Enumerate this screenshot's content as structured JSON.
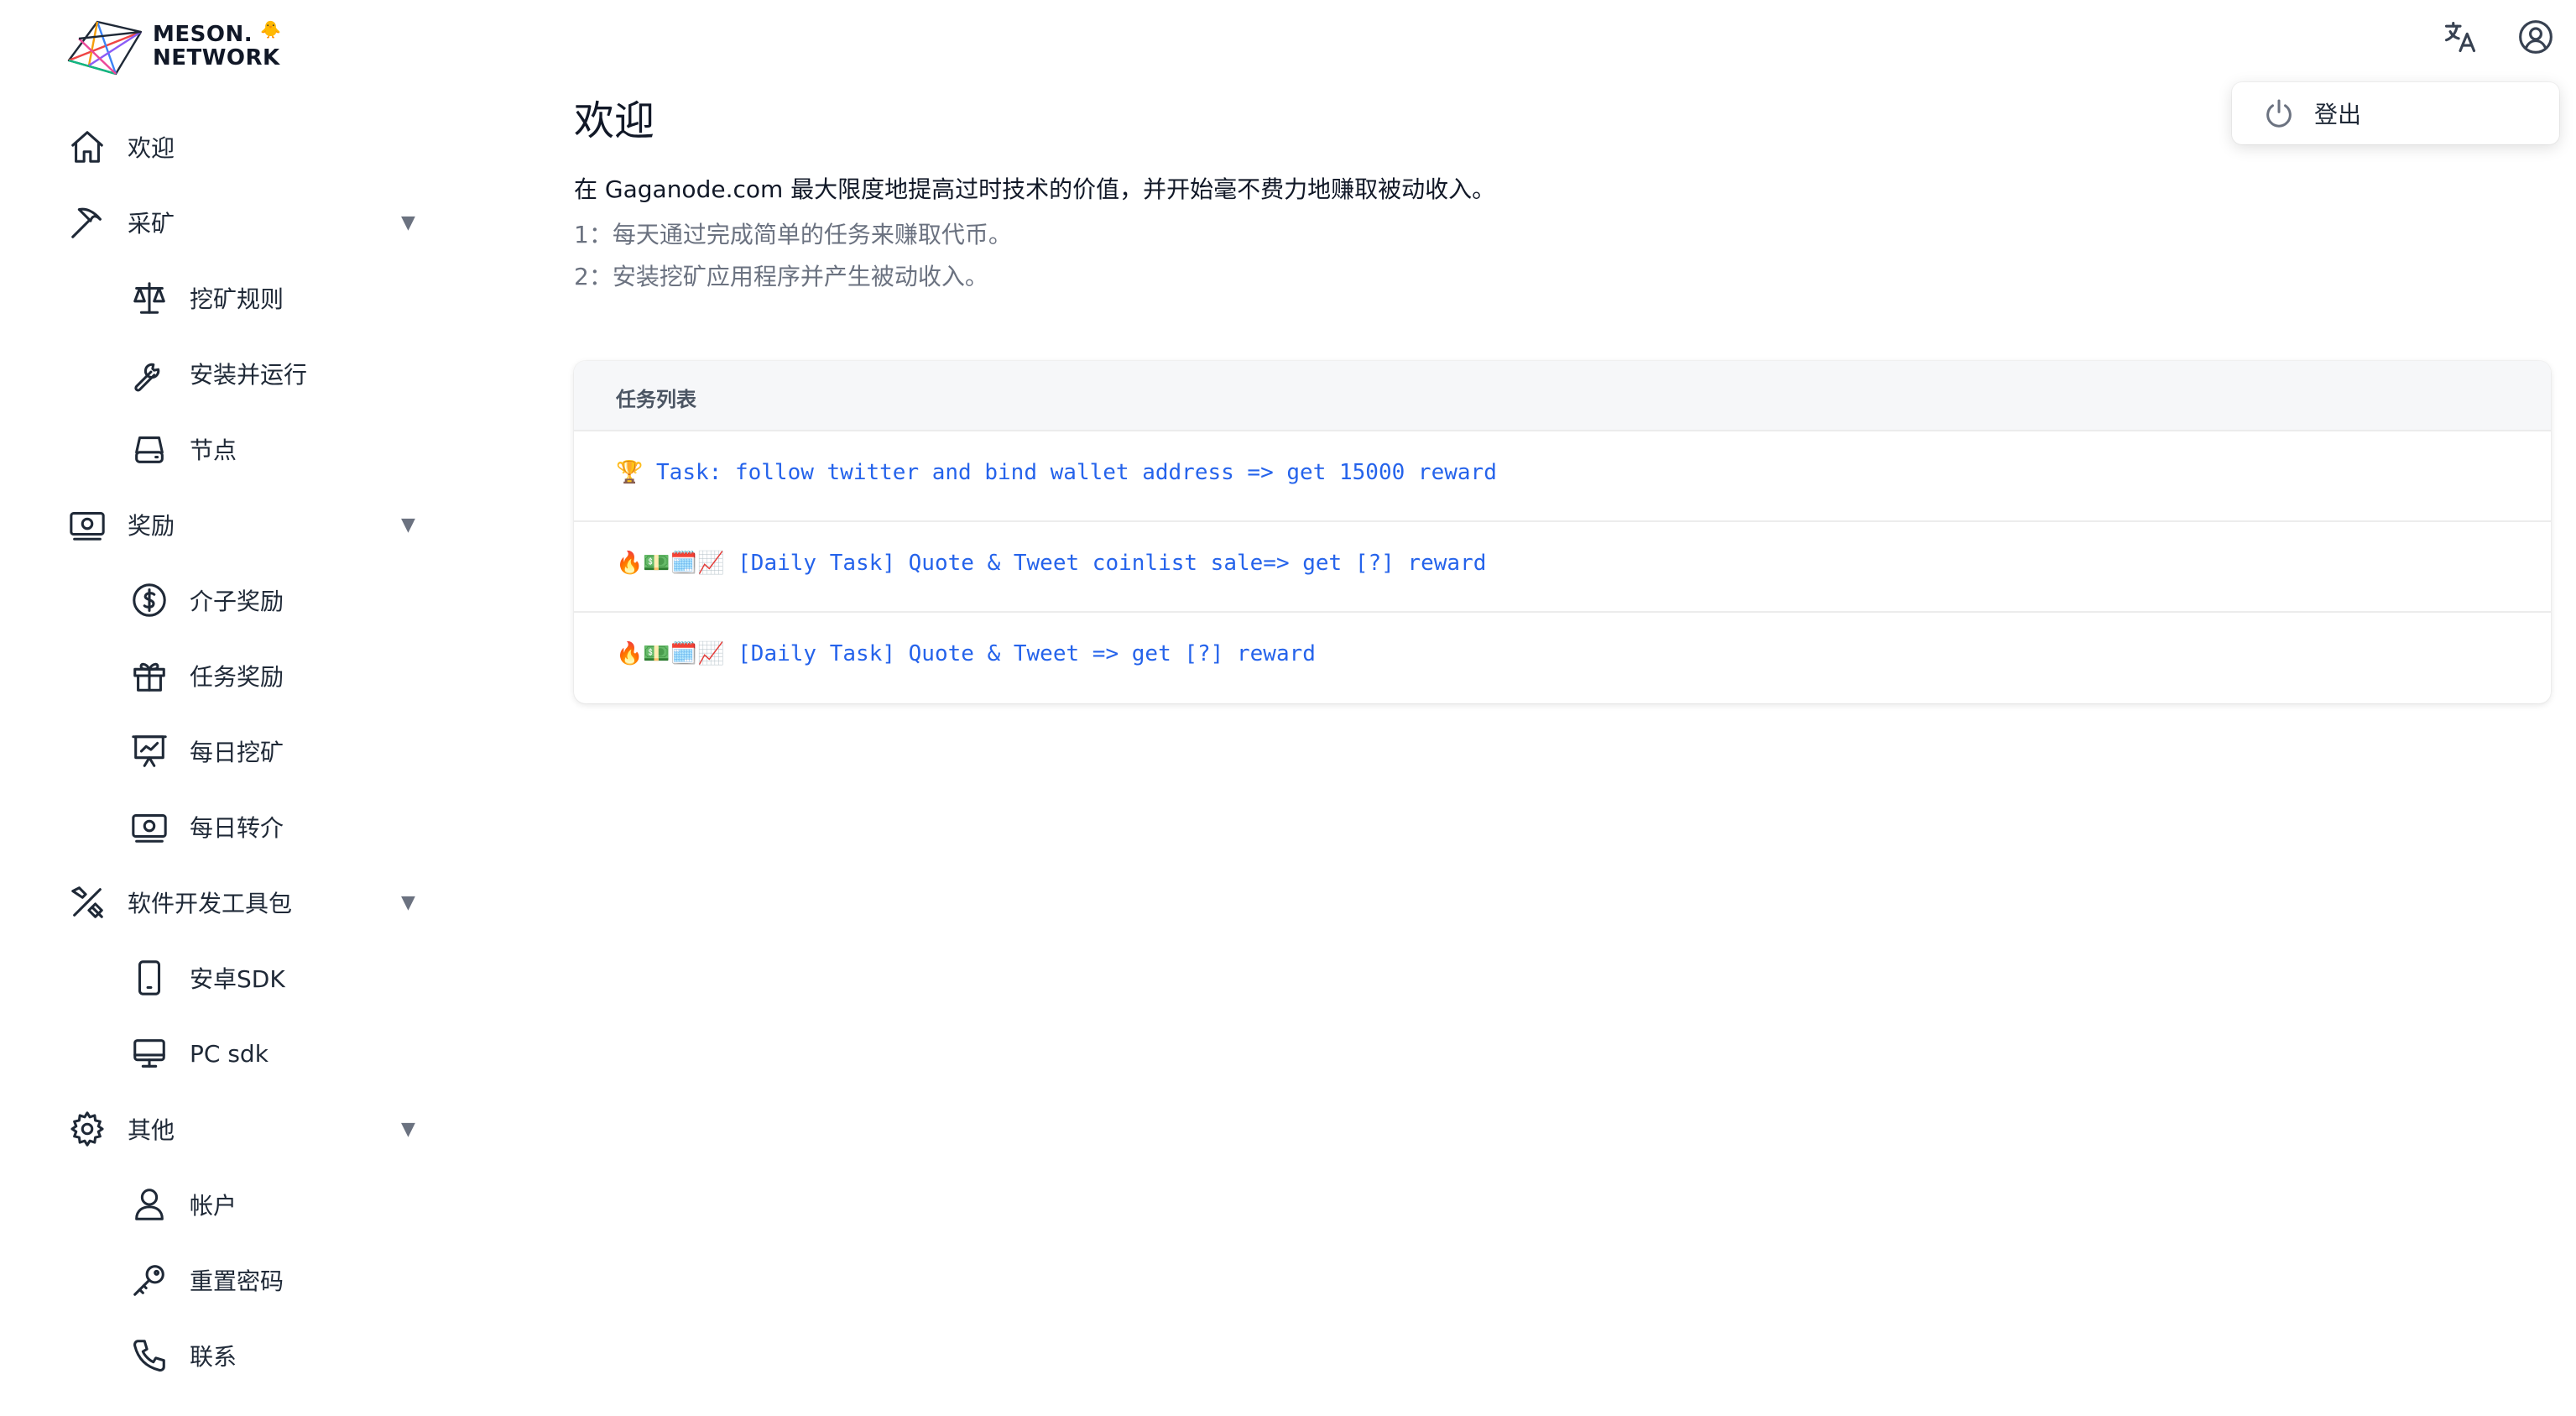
{
  "brand": {
    "line1": "MESON.",
    "line2": "NETWORK",
    "mascot": "🐥",
    "accent": "#2563eb"
  },
  "sidebar": {
    "items": [
      {
        "label": "欢迎",
        "icon": "home-icon",
        "level": 1
      },
      {
        "label": "采矿",
        "icon": "pickaxe-icon",
        "level": 1,
        "expanded": true
      },
      {
        "label": "挖矿规则",
        "icon": "scale-icon",
        "level": 2
      },
      {
        "label": "安装并运行",
        "icon": "wrench-icon",
        "level": 2
      },
      {
        "label": "节点",
        "icon": "harddrive-icon",
        "level": 2
      },
      {
        "label": "奖励",
        "icon": "banknote-icon",
        "level": 1,
        "expanded": true
      },
      {
        "label": "介子奖励",
        "icon": "dollar-circle-icon",
        "level": 2
      },
      {
        "label": "任务奖励",
        "icon": "gift-icon",
        "level": 2
      },
      {
        "label": "每日挖矿",
        "icon": "presentation-chart-icon",
        "level": 2
      },
      {
        "label": "每日转介",
        "icon": "banknote-icon",
        "level": 2
      },
      {
        "label": "软件开发工具包",
        "icon": "tools-icon",
        "level": 1,
        "expanded": true
      },
      {
        "label": "安卓SDK",
        "icon": "phone-icon",
        "level": 2
      },
      {
        "label": "PC sdk",
        "icon": "monitor-icon",
        "level": 2
      },
      {
        "label": "其他",
        "icon": "gear-icon",
        "level": 1,
        "expanded": true
      },
      {
        "label": "帐户",
        "icon": "user-icon",
        "level": 2
      },
      {
        "label": "重置密码",
        "icon": "key-icon",
        "level": 2
      },
      {
        "label": "联系",
        "icon": "phone-call-icon",
        "level": 2
      }
    ],
    "caret": "▼"
  },
  "header": {
    "translate_icon": "translate-icon",
    "account_icon": "user-circle-icon"
  },
  "account_menu": {
    "logout_label": "登出",
    "logout_icon": "power-icon"
  },
  "main": {
    "title": "欢迎",
    "intro": "在 Gaganode.com 最大限度地提高过时技术的价值，并开始毫不费力地赚取被动收入。",
    "bullets": [
      "1：每天通过完成简单的任务来赚取代币。",
      "2：安装挖矿应用程序并产生被动收入。"
    ],
    "tasks": {
      "header": "任务列表",
      "items": [
        {
          "emoji": "🏆",
          "text": "Task: follow twitter and bind wallet address => get 15000 reward"
        },
        {
          "emoji": "🔥💵🗓️📈",
          "text": "[Daily Task] Quote & Tweet coinlist sale=> get [?] reward"
        },
        {
          "emoji": "🔥💵🗓️📈",
          "text": "[Daily Task] Quote & Tweet => get [?] reward"
        }
      ]
    }
  }
}
